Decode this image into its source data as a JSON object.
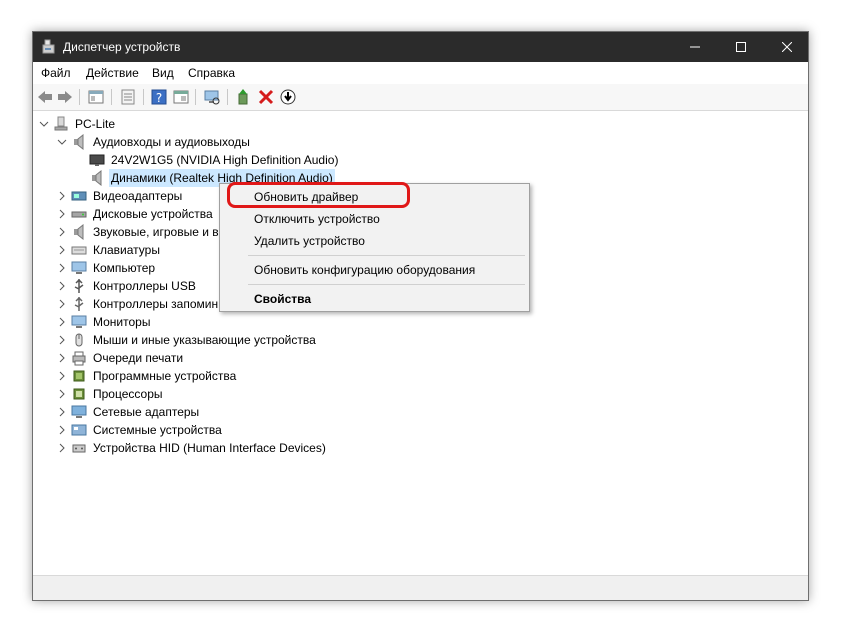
{
  "window": {
    "title": "Диспетчер устройств"
  },
  "menu": [
    "Файл",
    "Действие",
    "Вид",
    "Справка"
  ],
  "tree": {
    "root": "PC-Lite",
    "audio": {
      "label": "Аудиовходы и аудиовыходы",
      "children": [
        "24V2W1G5 (NVIDIA High Definition Audio)",
        "Динамики (Realtek High Definition Audio)"
      ]
    },
    "categories": [
      "Видеоадаптеры",
      "Дисковые устройства",
      "Звуковые, игровые и в",
      "Клавиатуры",
      "Компьютер",
      "Контроллеры USB",
      "Контроллеры запомин",
      "Мониторы",
      "Мыши и иные указывающие устройства",
      "Очереди печати",
      "Программные устройства",
      "Процессоры",
      "Сетевые адаптеры",
      "Системные устройства",
      "Устройства HID (Human Interface Devices)"
    ]
  },
  "context_menu": {
    "update_driver": "Обновить драйвер",
    "disable": "Отключить устройство",
    "uninstall": "Удалить устройство",
    "scan": "Обновить конфигурацию оборудования",
    "properties": "Свойства"
  },
  "colors": {
    "titlebar": "#2b2b2b",
    "selection": "#cce8ff",
    "highlight": "#e01818"
  },
  "icons": {
    "category": [
      "display-adapter-icon",
      "disk-drive-icon",
      "sound-icon",
      "keyboard-icon",
      "computer-icon",
      "usb-icon",
      "storage-controller-icon",
      "monitor-icon",
      "mouse-icon",
      "print-queue-icon",
      "software-device-icon",
      "processor-icon",
      "network-adapter-icon",
      "system-device-icon",
      "hid-icon"
    ]
  }
}
